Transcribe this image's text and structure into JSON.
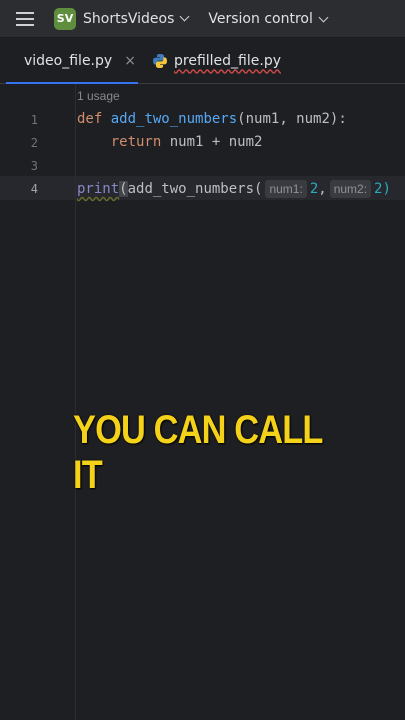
{
  "topbar": {
    "project_badge": "SV",
    "project_name": "ShortsVideos",
    "version_control": "Version control"
  },
  "tabs": [
    {
      "label": "video_file.py",
      "active": true,
      "closable": true
    },
    {
      "label": "prefilled_file.py",
      "active": false
    }
  ],
  "editor": {
    "usage_hint": "1 usage",
    "line_numbers": [
      "1",
      "2",
      "3",
      "4"
    ],
    "line1": {
      "kw": "def",
      "fn": "add_two_numbers",
      "rest": "(num1, num2):"
    },
    "line2": {
      "kw": "return",
      "rest": " num1 + num2"
    },
    "line4": {
      "builtin": "print",
      "open": "(",
      "call": "add_two_numbers(",
      "hint1": "num1:",
      "val1": "2",
      "comma": ",",
      "hint2": "num2:",
      "val2": "2)"
    }
  },
  "caption": "YOU CAN CALL IT",
  "colors": {
    "caption": "#f5d21a",
    "keyword": "#cf8e6d",
    "function": "#56a8f5",
    "number": "#2aacb8"
  }
}
